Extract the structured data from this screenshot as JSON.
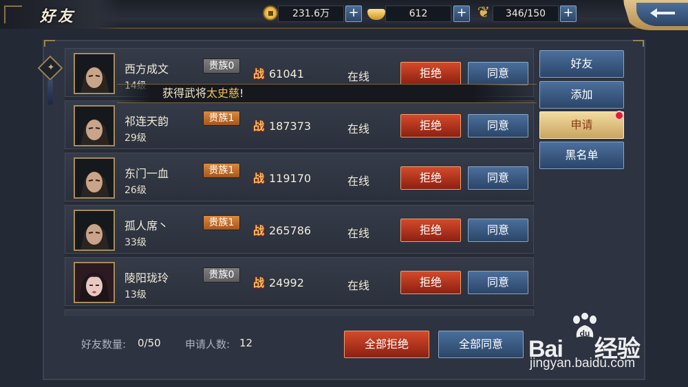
{
  "header": {
    "title": "好友",
    "resources": [
      {
        "icon": "gold-coin-icon",
        "value": "231.6万"
      },
      {
        "icon": "silver-ingot-icon",
        "value": "612"
      },
      {
        "icon": "wheat-icon",
        "value": "346/150"
      }
    ],
    "plus_label": "+",
    "back_icon": "back-arrow-icon"
  },
  "tabs": [
    {
      "label": "好友",
      "active": false
    },
    {
      "label": "添加",
      "active": false
    },
    {
      "label": "申请",
      "active": true,
      "badge": "red-dot"
    },
    {
      "label": "黑名单",
      "active": false
    }
  ],
  "notice": {
    "prefix": "获得武将",
    "highlight": "太史慈",
    "suffix": "!"
  },
  "requests": [
    {
      "name": "西方成文",
      "level": "14级",
      "noble": "贵族0",
      "power": "61041",
      "status": "在线",
      "reject": "拒绝",
      "accept": "同意"
    },
    {
      "name": "祁连天韵",
      "level": "29级",
      "noble": "贵族1",
      "power": "187373",
      "status": "在线",
      "reject": "拒绝",
      "accept": "同意"
    },
    {
      "name": "东门一血",
      "level": "26级",
      "noble": "贵族1",
      "power": "119170",
      "status": "在线",
      "reject": "拒绝",
      "accept": "同意"
    },
    {
      "name": "孤人席丶",
      "level": "33级",
      "noble": "贵族1",
      "power": "265786",
      "status": "在线",
      "reject": "拒绝",
      "accept": "同意"
    },
    {
      "name": "陵阳珑玲",
      "level": "13级",
      "noble": "贵族0",
      "power": "24992",
      "status": "在线",
      "reject": "拒绝",
      "accept": "同意"
    }
  ],
  "war_glyph": "战",
  "footer": {
    "friend_count_label": "好友数量:",
    "friend_count_value": "0/50",
    "applicant_label": "申请人数:",
    "applicant_value": "12",
    "reject_all": "全部拒绝",
    "accept_all": "全部同意"
  },
  "watermark": {
    "brand": "Bai",
    "brand2": "经验",
    "url": "jingyan.baidu.com"
  },
  "colors": {
    "reject": "#b8341c",
    "accept": "#3a5a84",
    "tab_active": "#e3c483",
    "highlight": "#f2c04a"
  }
}
